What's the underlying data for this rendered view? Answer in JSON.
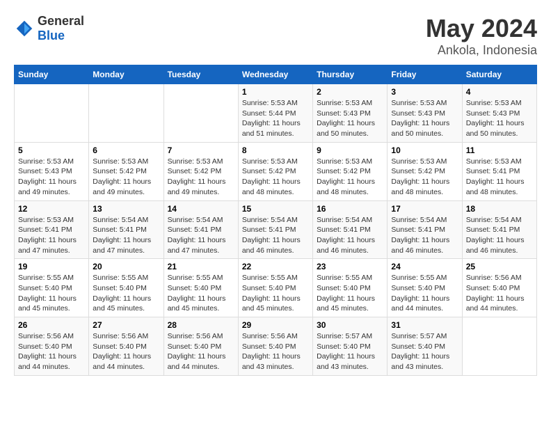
{
  "logo": {
    "general": "General",
    "blue": "Blue"
  },
  "title": "May 2024",
  "subtitle": "Ankola, Indonesia",
  "days_of_week": [
    "Sunday",
    "Monday",
    "Tuesday",
    "Wednesday",
    "Thursday",
    "Friday",
    "Saturday"
  ],
  "weeks": [
    [
      {
        "day": "",
        "info": ""
      },
      {
        "day": "",
        "info": ""
      },
      {
        "day": "",
        "info": ""
      },
      {
        "day": "1",
        "info": "Sunrise: 5:53 AM\nSunset: 5:44 PM\nDaylight: 11 hours and 51 minutes."
      },
      {
        "day": "2",
        "info": "Sunrise: 5:53 AM\nSunset: 5:43 PM\nDaylight: 11 hours and 50 minutes."
      },
      {
        "day": "3",
        "info": "Sunrise: 5:53 AM\nSunset: 5:43 PM\nDaylight: 11 hours and 50 minutes."
      },
      {
        "day": "4",
        "info": "Sunrise: 5:53 AM\nSunset: 5:43 PM\nDaylight: 11 hours and 50 minutes."
      }
    ],
    [
      {
        "day": "5",
        "info": "Sunrise: 5:53 AM\nSunset: 5:43 PM\nDaylight: 11 hours and 49 minutes."
      },
      {
        "day": "6",
        "info": "Sunrise: 5:53 AM\nSunset: 5:42 PM\nDaylight: 11 hours and 49 minutes."
      },
      {
        "day": "7",
        "info": "Sunrise: 5:53 AM\nSunset: 5:42 PM\nDaylight: 11 hours and 49 minutes."
      },
      {
        "day": "8",
        "info": "Sunrise: 5:53 AM\nSunset: 5:42 PM\nDaylight: 11 hours and 48 minutes."
      },
      {
        "day": "9",
        "info": "Sunrise: 5:53 AM\nSunset: 5:42 PM\nDaylight: 11 hours and 48 minutes."
      },
      {
        "day": "10",
        "info": "Sunrise: 5:53 AM\nSunset: 5:42 PM\nDaylight: 11 hours and 48 minutes."
      },
      {
        "day": "11",
        "info": "Sunrise: 5:53 AM\nSunset: 5:41 PM\nDaylight: 11 hours and 48 minutes."
      }
    ],
    [
      {
        "day": "12",
        "info": "Sunrise: 5:53 AM\nSunset: 5:41 PM\nDaylight: 11 hours and 47 minutes."
      },
      {
        "day": "13",
        "info": "Sunrise: 5:54 AM\nSunset: 5:41 PM\nDaylight: 11 hours and 47 minutes."
      },
      {
        "day": "14",
        "info": "Sunrise: 5:54 AM\nSunset: 5:41 PM\nDaylight: 11 hours and 47 minutes."
      },
      {
        "day": "15",
        "info": "Sunrise: 5:54 AM\nSunset: 5:41 PM\nDaylight: 11 hours and 46 minutes."
      },
      {
        "day": "16",
        "info": "Sunrise: 5:54 AM\nSunset: 5:41 PM\nDaylight: 11 hours and 46 minutes."
      },
      {
        "day": "17",
        "info": "Sunrise: 5:54 AM\nSunset: 5:41 PM\nDaylight: 11 hours and 46 minutes."
      },
      {
        "day": "18",
        "info": "Sunrise: 5:54 AM\nSunset: 5:41 PM\nDaylight: 11 hours and 46 minutes."
      }
    ],
    [
      {
        "day": "19",
        "info": "Sunrise: 5:55 AM\nSunset: 5:40 PM\nDaylight: 11 hours and 45 minutes."
      },
      {
        "day": "20",
        "info": "Sunrise: 5:55 AM\nSunset: 5:40 PM\nDaylight: 11 hours and 45 minutes."
      },
      {
        "day": "21",
        "info": "Sunrise: 5:55 AM\nSunset: 5:40 PM\nDaylight: 11 hours and 45 minutes."
      },
      {
        "day": "22",
        "info": "Sunrise: 5:55 AM\nSunset: 5:40 PM\nDaylight: 11 hours and 45 minutes."
      },
      {
        "day": "23",
        "info": "Sunrise: 5:55 AM\nSunset: 5:40 PM\nDaylight: 11 hours and 45 minutes."
      },
      {
        "day": "24",
        "info": "Sunrise: 5:55 AM\nSunset: 5:40 PM\nDaylight: 11 hours and 44 minutes."
      },
      {
        "day": "25",
        "info": "Sunrise: 5:56 AM\nSunset: 5:40 PM\nDaylight: 11 hours and 44 minutes."
      }
    ],
    [
      {
        "day": "26",
        "info": "Sunrise: 5:56 AM\nSunset: 5:40 PM\nDaylight: 11 hours and 44 minutes."
      },
      {
        "day": "27",
        "info": "Sunrise: 5:56 AM\nSunset: 5:40 PM\nDaylight: 11 hours and 44 minutes."
      },
      {
        "day": "28",
        "info": "Sunrise: 5:56 AM\nSunset: 5:40 PM\nDaylight: 11 hours and 44 minutes."
      },
      {
        "day": "29",
        "info": "Sunrise: 5:56 AM\nSunset: 5:40 PM\nDaylight: 11 hours and 43 minutes."
      },
      {
        "day": "30",
        "info": "Sunrise: 5:57 AM\nSunset: 5:40 PM\nDaylight: 11 hours and 43 minutes."
      },
      {
        "day": "31",
        "info": "Sunrise: 5:57 AM\nSunset: 5:40 PM\nDaylight: 11 hours and 43 minutes."
      },
      {
        "day": "",
        "info": ""
      }
    ]
  ]
}
